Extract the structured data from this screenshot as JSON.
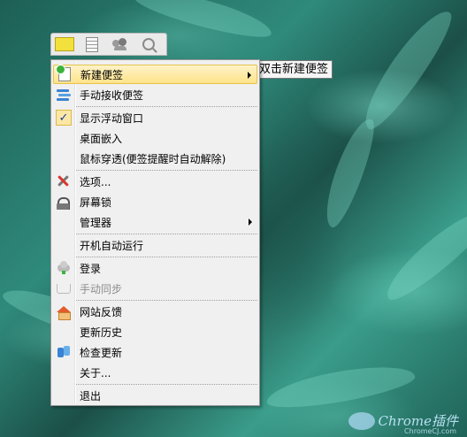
{
  "tooltip": {
    "text": "双击新建便签"
  },
  "toolbar": {
    "buttons": [
      {
        "icon": "note-icon"
      },
      {
        "icon": "list-icon"
      },
      {
        "icon": "users-icon"
      },
      {
        "icon": "search-icon"
      }
    ]
  },
  "menu": {
    "items": [
      {
        "label": "新建便签",
        "icon": "new-note-icon",
        "submenu": true,
        "highlighted": true
      },
      {
        "label": "手动接收便签",
        "icon": "receive-icon"
      },
      {
        "label": "显示浮动窗口",
        "icon": "check-icon",
        "checked": true
      },
      {
        "label": "桌面嵌入"
      },
      {
        "label": "鼠标穿透(便签提醒时自动解除)"
      },
      {
        "label": "选项...",
        "icon": "tools-icon"
      },
      {
        "label": "屏幕锁",
        "icon": "lock-icon"
      },
      {
        "label": "管理器",
        "submenu": true
      },
      {
        "label": "开机自动运行"
      },
      {
        "label": "登录",
        "icon": "cloud-icon"
      },
      {
        "label": "手动同步",
        "icon": "sync-icon",
        "disabled": true
      },
      {
        "label": "网站反馈",
        "icon": "home-icon"
      },
      {
        "label": "更新历史"
      },
      {
        "label": "检查更新",
        "icon": "update-icon"
      },
      {
        "label": "关于..."
      },
      {
        "label": "退出"
      }
    ]
  },
  "watermark": {
    "text": "Chrome插件",
    "sub": "ChromeCJ.com"
  },
  "colors": {
    "highlight": "#fde38a",
    "menu_bg": "#f0f0f0",
    "note_yellow": "#f2e13c"
  }
}
